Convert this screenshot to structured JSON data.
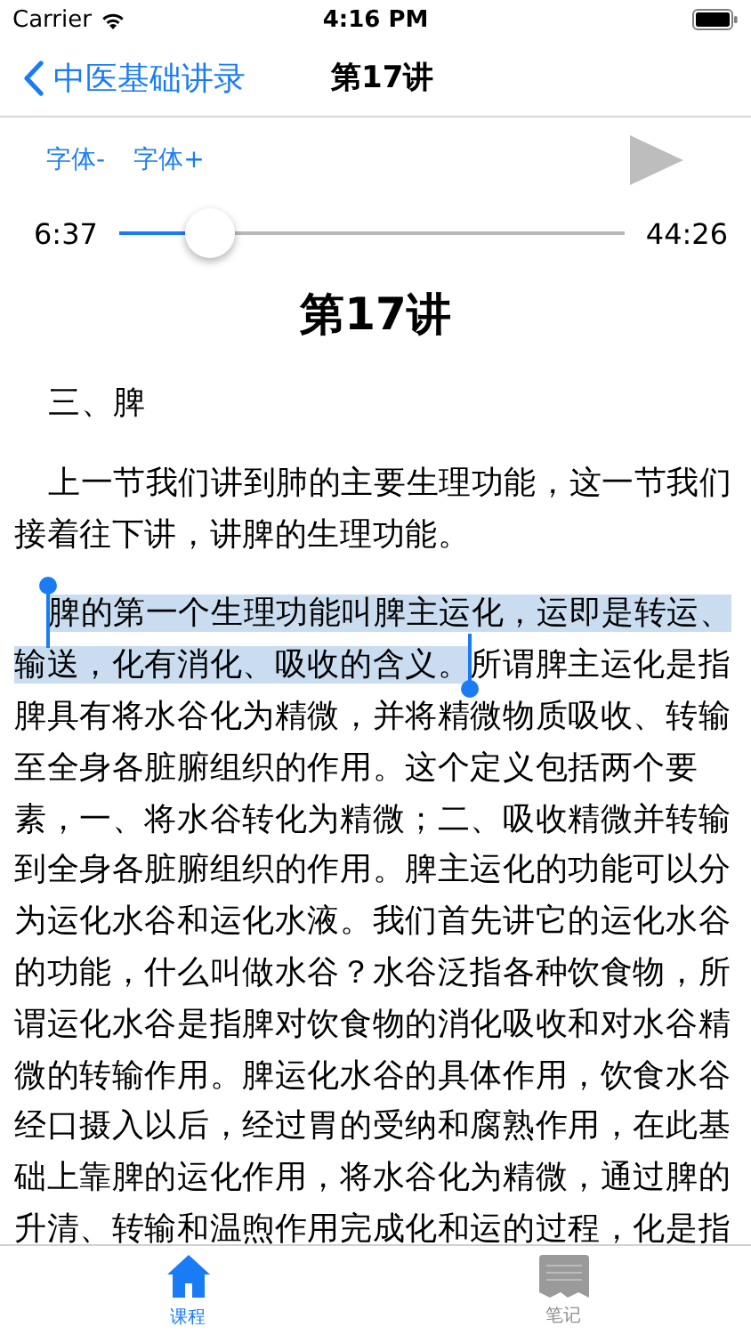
{
  "status_bar": {
    "carrier": "Carrier",
    "time": "4:16 PM"
  },
  "nav_bar": {
    "back_label": "中医基础讲录",
    "title": "第17讲"
  },
  "font_buttons": [
    "字体-",
    "字体+"
  ],
  "player": {
    "playing": false,
    "elapsed": "6:37",
    "duration": "44:26",
    "level": 0.18
  },
  "lecture": {
    "title": "第17讲",
    "heading": "三、脾",
    "paragraphs": [
      {
        "before": "上一节我们讲到肺的主要生理功能，这一节我们接着往下讲，讲脾的生理功能。"
      },
      {
        "selected": "脾的第一个生理功能叫脾主运化，运即是转运、输送，化有消化、吸收的含义。",
        "after": "所谓脾主运化是指脾具有将水谷化为精微，并将精微物质吸收、转输至全身各脏腑组织的作用。这个定义包括两个要素，一、将水谷转化为精微；二、吸收精微并转输到全身各脏腑组织的作用。脾主运化的功能可以分为运化水谷和运化水液。我们首先讲它的运化水谷的功能，什么叫做水谷？水谷泛指各种饮食物，所谓运化水谷是指脾对饮食物的消化吸收和对水谷精微的转输作用。脾运化水谷的具体作用，饮食水谷经口摄入以后，经过胃的受纳和腐熟作用，在此基础上靠脾的运化作用，将水谷化为精微，通过脾的升清、转输和温煦作用完成化和运的过程，化是指"
      }
    ]
  },
  "tab_bar": [
    {
      "label": "课程",
      "selected": true
    },
    {
      "label": "笔记",
      "selected": false
    }
  ]
}
